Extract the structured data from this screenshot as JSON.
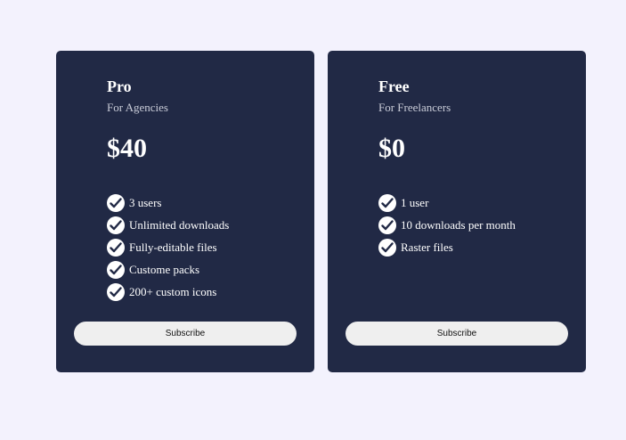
{
  "colors": {
    "page_background": "#f3f2fd",
    "card_background": "#212945",
    "button_background": "#efefef",
    "text_primary": "#ffffff",
    "text_secondary": "#c9ccd8"
  },
  "plans": [
    {
      "name": "Pro",
      "subtitle": "For Agencies",
      "price": "$40",
      "features": [
        "3 users",
        "Unlimited downloads",
        "Fully-editable files",
        "Custome packs",
        "200+ custom icons"
      ],
      "button_label": "Subscribe",
      "feature_icon": "check-circle-icon"
    },
    {
      "name": "Free",
      "subtitle": "For Freelancers",
      "price": "$0",
      "features": [
        "1 user",
        "10 downloads per month",
        "Raster files"
      ],
      "button_label": "Subscribe",
      "feature_icon": "check-circle-icon"
    }
  ]
}
